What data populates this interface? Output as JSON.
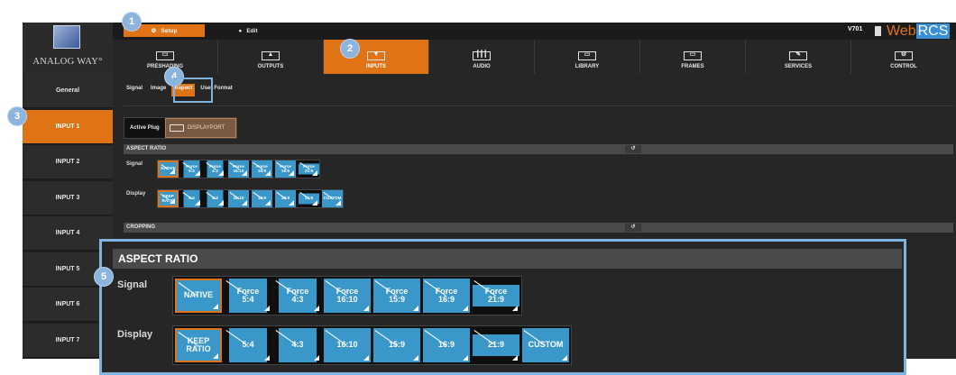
{
  "brand": {
    "logo_text": "ANALOG WAY°",
    "version": "V701",
    "app_web": "Web",
    "app_rcs": "RCS"
  },
  "top_tabs": [
    {
      "label": "Setup",
      "icon": "gear-icon",
      "active": true
    },
    {
      "label": "Edit",
      "icon": "play-icon",
      "active": false
    }
  ],
  "menu": [
    {
      "label": "PRESHADING",
      "icon": "preshading-icon",
      "active": false
    },
    {
      "label": "OUTPUTS",
      "icon": "outputs-icon",
      "active": false
    },
    {
      "label": "INPUTS",
      "icon": "inputs-icon",
      "active": true
    },
    {
      "label": "AUDIO",
      "icon": "audio-icon",
      "active": false
    },
    {
      "label": "LIBRARY",
      "icon": "library-icon",
      "active": false
    },
    {
      "label": "FRAMES",
      "icon": "frames-icon",
      "active": false
    },
    {
      "label": "SERVICES",
      "icon": "services-icon",
      "active": false
    },
    {
      "label": "CONTROL",
      "icon": "control-icon",
      "active": false
    }
  ],
  "sidebar": [
    {
      "label": "General",
      "active": false
    },
    {
      "label": "INPUT 1",
      "active": true
    },
    {
      "label": "INPUT 2",
      "active": false
    },
    {
      "label": "INPUT 3",
      "active": false
    },
    {
      "label": "INPUT 4",
      "active": false
    },
    {
      "label": "INPUT 5",
      "active": false
    },
    {
      "label": "INPUT 6",
      "active": false
    },
    {
      "label": "INPUT 7",
      "active": false
    }
  ],
  "subtabs": [
    {
      "label": "Signal",
      "active": false
    },
    {
      "label": "Image",
      "active": false
    },
    {
      "label": "Aspect",
      "active": true
    },
    {
      "label": "User Format",
      "active": false
    }
  ],
  "active_plug": {
    "label": "Active Plug",
    "value": "DISPLAYPORT"
  },
  "sections": {
    "aspect_ratio": "ASPECT RATIO",
    "cropping": "CROPPING",
    "zoom_title": "ASPECT RATIO"
  },
  "signal": {
    "label": "Signal",
    "buttons": [
      {
        "l1": "NATIVE",
        "l2": "",
        "selected": true
      },
      {
        "l1": "Force",
        "l2": "5:4",
        "selected": false
      },
      {
        "l1": "Force",
        "l2": "4:3",
        "selected": false
      },
      {
        "l1": "Force",
        "l2": "16:10",
        "selected": false
      },
      {
        "l1": "Force",
        "l2": "15:9",
        "selected": false
      },
      {
        "l1": "Force",
        "l2": "16:9",
        "selected": false
      },
      {
        "l1": "Force",
        "l2": "21:9",
        "selected": false
      }
    ]
  },
  "display": {
    "label": "Display",
    "buttons": [
      {
        "l1": "KEEP",
        "l2": "RATIO",
        "selected": true
      },
      {
        "l1": "5:4",
        "l2": "",
        "selected": false
      },
      {
        "l1": "4:3",
        "l2": "",
        "selected": false
      },
      {
        "l1": "16:10",
        "l2": "",
        "selected": false
      },
      {
        "l1": "15:9",
        "l2": "",
        "selected": false
      },
      {
        "l1": "16:9",
        "l2": "",
        "selected": false
      },
      {
        "l1": "21:9",
        "l2": "",
        "selected": false
      },
      {
        "l1": "CUSTOM",
        "l2": "",
        "selected": false
      }
    ]
  },
  "callouts": [
    "1",
    "2",
    "3",
    "4",
    "5"
  ],
  "colors": {
    "accent": "#e07316",
    "button_blue": "#3a97c9",
    "highlight": "#7fb3e0"
  }
}
